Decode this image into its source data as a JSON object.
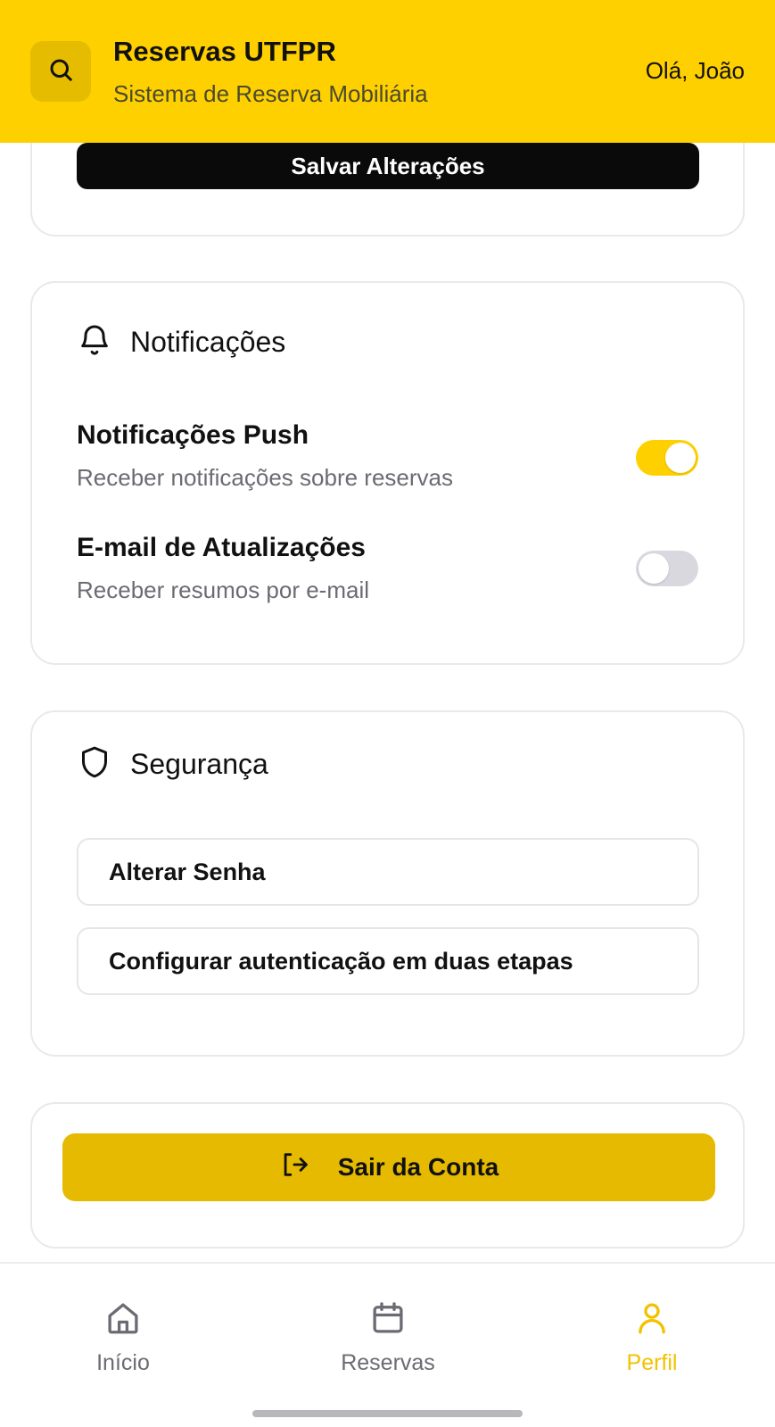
{
  "header": {
    "title": "Reservas UTFPR",
    "subtitle": "Sistema de Reserva Mobiliária",
    "greeting": "Olá, João",
    "search_icon": "search-icon",
    "background_color": "#FFD000"
  },
  "profile_form": {
    "save_label": "Salvar Alterações"
  },
  "notifications": {
    "heading": "Notificações",
    "icon": "bell-icon",
    "items": [
      {
        "title": "Notificações Push",
        "description": "Receber notificações sobre reservas",
        "enabled": true
      },
      {
        "title": "E-mail de Atualizações",
        "description": "Receber resumos por e-mail",
        "enabled": false
      }
    ]
  },
  "security": {
    "heading": "Segurança",
    "icon": "shield-icon",
    "buttons": [
      {
        "label": "Alterar Senha"
      },
      {
        "label": "Configurar autenticação em duas etapas"
      }
    ]
  },
  "logout": {
    "label": "Sair da Conta",
    "icon": "logout-icon",
    "color": "#E6BA00"
  },
  "bottom_nav": {
    "items": [
      {
        "label": "Início",
        "icon": "home-icon",
        "active": false
      },
      {
        "label": "Reservas",
        "icon": "calendar-icon",
        "active": false
      },
      {
        "label": "Perfil",
        "icon": "user-icon",
        "active": true
      }
    ],
    "active_color": "#F2C200"
  }
}
